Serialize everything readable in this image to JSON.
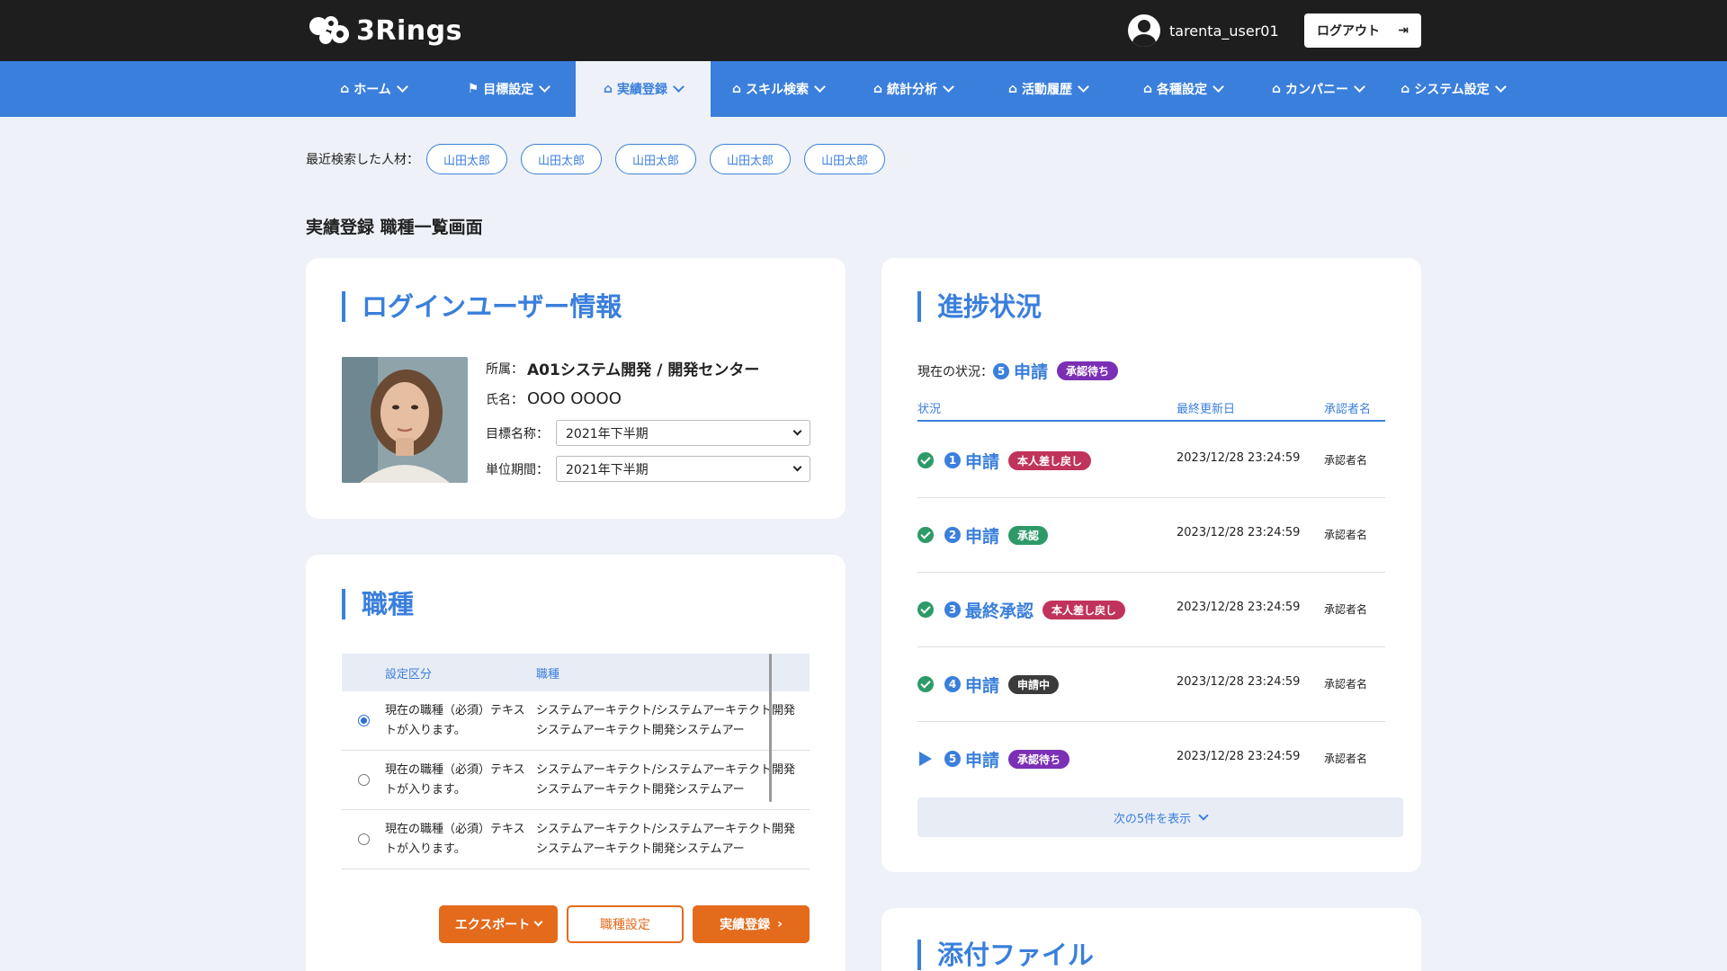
{
  "app": {
    "logo_text": "3Rings"
  },
  "header": {
    "user_name": "tarenta_user01",
    "logout_label": "ログアウト"
  },
  "nav": [
    {
      "label": "ホーム",
      "icon": "home-icon"
    },
    {
      "label": "目標設定",
      "icon": "flag-icon"
    },
    {
      "label": "実績登録",
      "icon": "home-icon",
      "active": true
    },
    {
      "label": "スキル検索",
      "icon": "home-icon"
    },
    {
      "label": "統計分析",
      "icon": "home-icon"
    },
    {
      "label": "活動履歴",
      "icon": "home-icon"
    },
    {
      "label": "各種設定",
      "icon": "home-icon"
    },
    {
      "label": "カンパニー",
      "icon": "home-icon"
    },
    {
      "label": "システム設定",
      "icon": "home-icon"
    }
  ],
  "recent": {
    "label": "最近検索した人材：",
    "people": [
      "山田太郎",
      "山田太郎",
      "山田太郎",
      "山田太郎",
      "山田太郎"
    ]
  },
  "page_title": "実績登録 職種一覧画面",
  "login_card": {
    "title": "ログインユーザー情報",
    "dept_label": "所属：",
    "dept_value": "A01システム開発 / 開発センター",
    "name_label": "氏名：",
    "name_value": "OOO OOOO",
    "goal_label": "目標名称：",
    "goal_value": "2021年下半期",
    "period_label": "単位期間：",
    "period_value": "2021年下半期"
  },
  "job_card": {
    "title": "職種",
    "columns": [
      "設定区分",
      "職種"
    ],
    "rows": [
      {
        "selected": true,
        "category": "現在の職種（必須）テキストが入ります。",
        "job": "システムアーキテクト/システムアーキテクト開発システムアーキテクト開発システムアー"
      },
      {
        "selected": false,
        "category": "現在の職種（必須）テキストが入ります。",
        "job": "システムアーキテクト/システムアーキテクト開発システムアーキテクト開発システムアー"
      },
      {
        "selected": false,
        "category": "現在の職種（必須）テキストが入ります。",
        "job": "システムアーキテクト/システムアーキテクト開発システムアーキテクト開発システムアー"
      }
    ],
    "export_label": "エクスポート",
    "job_settings_label": "職種設定",
    "register_label": "実績登録"
  },
  "progress_card": {
    "title": "進捗状況",
    "current_label": "現在の状況：",
    "current_number": "5",
    "current_step": "申請",
    "current_badge": "承認待ち",
    "columns": {
      "status": "状況",
      "updated": "最終更新日",
      "approver": "承認者名"
    },
    "rows": [
      {
        "number": "1",
        "step": "申請",
        "badge": "本人差し戻し",
        "badge_color": "#c0335a",
        "date": "2023/12/28 23:24:59",
        "approver": "承認者名",
        "done": true
      },
      {
        "number": "2",
        "step": "申請",
        "badge": "承認",
        "badge_color": "#2e9a68",
        "date": "2023/12/28 23:24:59",
        "approver": "承認者名",
        "done": true
      },
      {
        "number": "3",
        "step": "最終承認",
        "badge": "本人差し戻し",
        "badge_color": "#c0335a",
        "date": "2023/12/28 23:24:59",
        "approver": "承認者名",
        "done": true
      },
      {
        "number": "4",
        "step": "申請",
        "badge": "申請中",
        "badge_color": "#3b3b3b",
        "date": "2023/12/28 23:24:59",
        "approver": "承認者名",
        "done": true
      },
      {
        "number": "5",
        "step": "申請",
        "badge": "承認待ち",
        "badge_color": "#7b2fb5",
        "date": "2023/12/28 23:24:59",
        "approver": "承認者名",
        "done": false
      }
    ],
    "more_label": "次の5件を表示"
  },
  "attach_card": {
    "title": "添付ファイル"
  },
  "colors": {
    "primary": "#3a7fdc",
    "accent": "#e46a1c",
    "header_bg": "#1e1e1e",
    "page_bg": "#eef1f7",
    "badge_waiting": "#7b2fb5"
  }
}
